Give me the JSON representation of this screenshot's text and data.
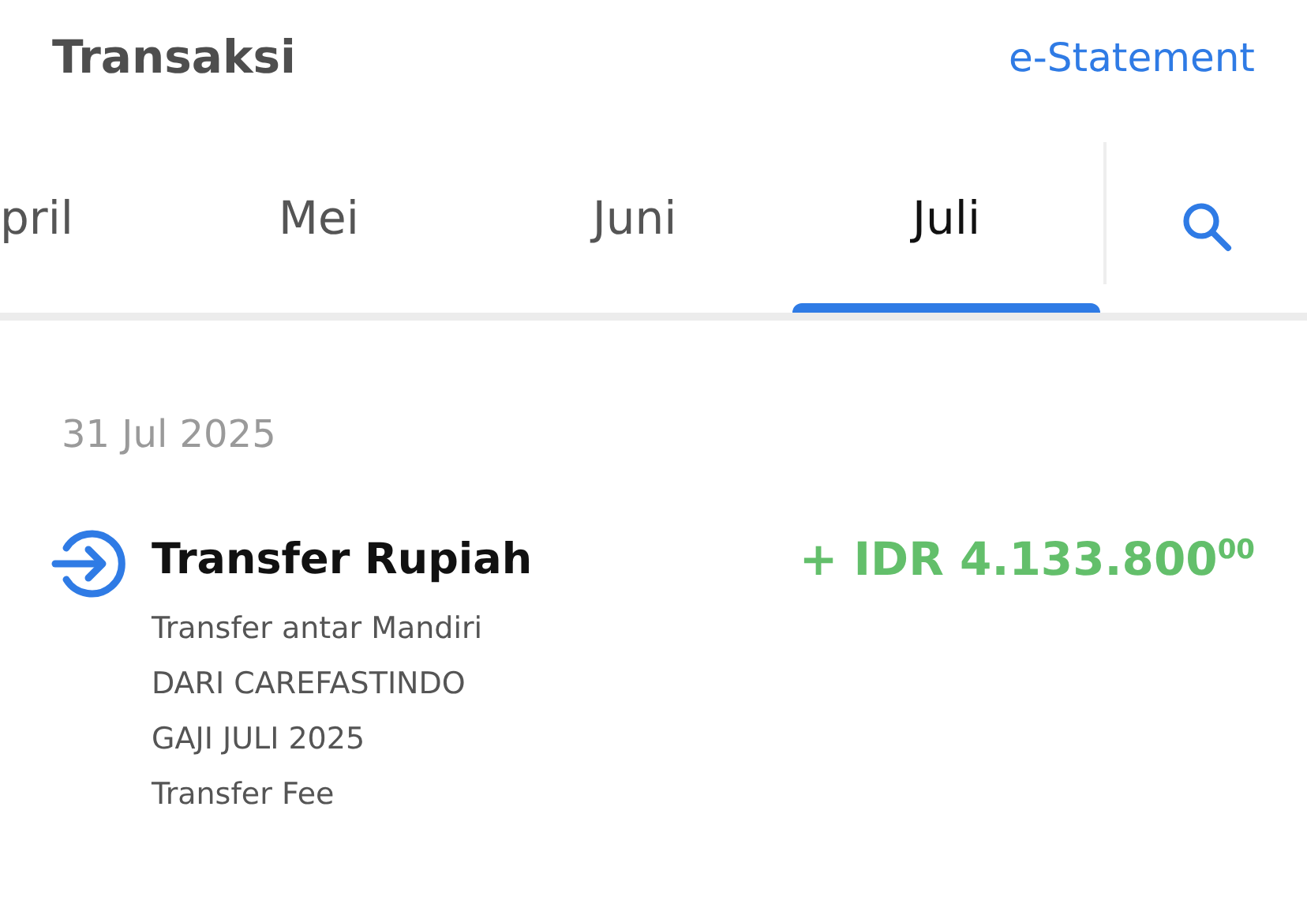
{
  "header": {
    "title": "Transaksi",
    "link": "e-Statement"
  },
  "tabs": [
    {
      "label": "pril",
      "selected": false
    },
    {
      "label": "Mei",
      "selected": false
    },
    {
      "label": "Juni",
      "selected": false
    },
    {
      "label": "Juli",
      "selected": true
    }
  ],
  "date": "31 Jul 2025",
  "transactions": [
    {
      "kind": "incoming",
      "title": "Transfer Rupiah",
      "amount": "+ IDR 4.133.800$^{00}$",
      "details": [
        "Transfer antar Mandiri",
        "DARI CAREFASTINDO",
        "GAJI JULI 2025",
        "Transfer Fee"
      ]
    }
  ]
}
